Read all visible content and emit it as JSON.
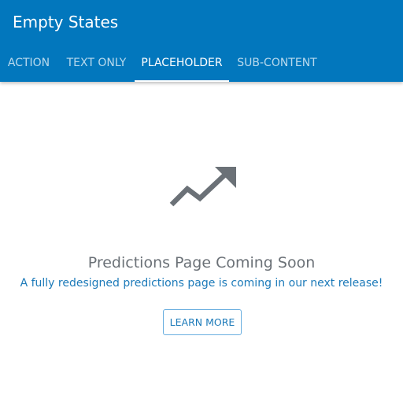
{
  "appbar": {
    "title": "Empty States",
    "background_color": "#0277BD"
  },
  "tabs": [
    {
      "label": "ACTION",
      "active": false
    },
    {
      "label": "TEXT ONLY",
      "active": false
    },
    {
      "label": "PLACEHOLDER",
      "active": true
    },
    {
      "label": "SUB-CONTENT",
      "active": false
    }
  ],
  "empty_state": {
    "icon": "trending-up-icon",
    "icon_color": "#6b7177",
    "title": "Predictions Page Coming Soon",
    "subtitle": "A fully redesigned predictions page is coming in our next release!",
    "action_label": "LEARN MORE",
    "accent_color": "#1c7ab9"
  }
}
